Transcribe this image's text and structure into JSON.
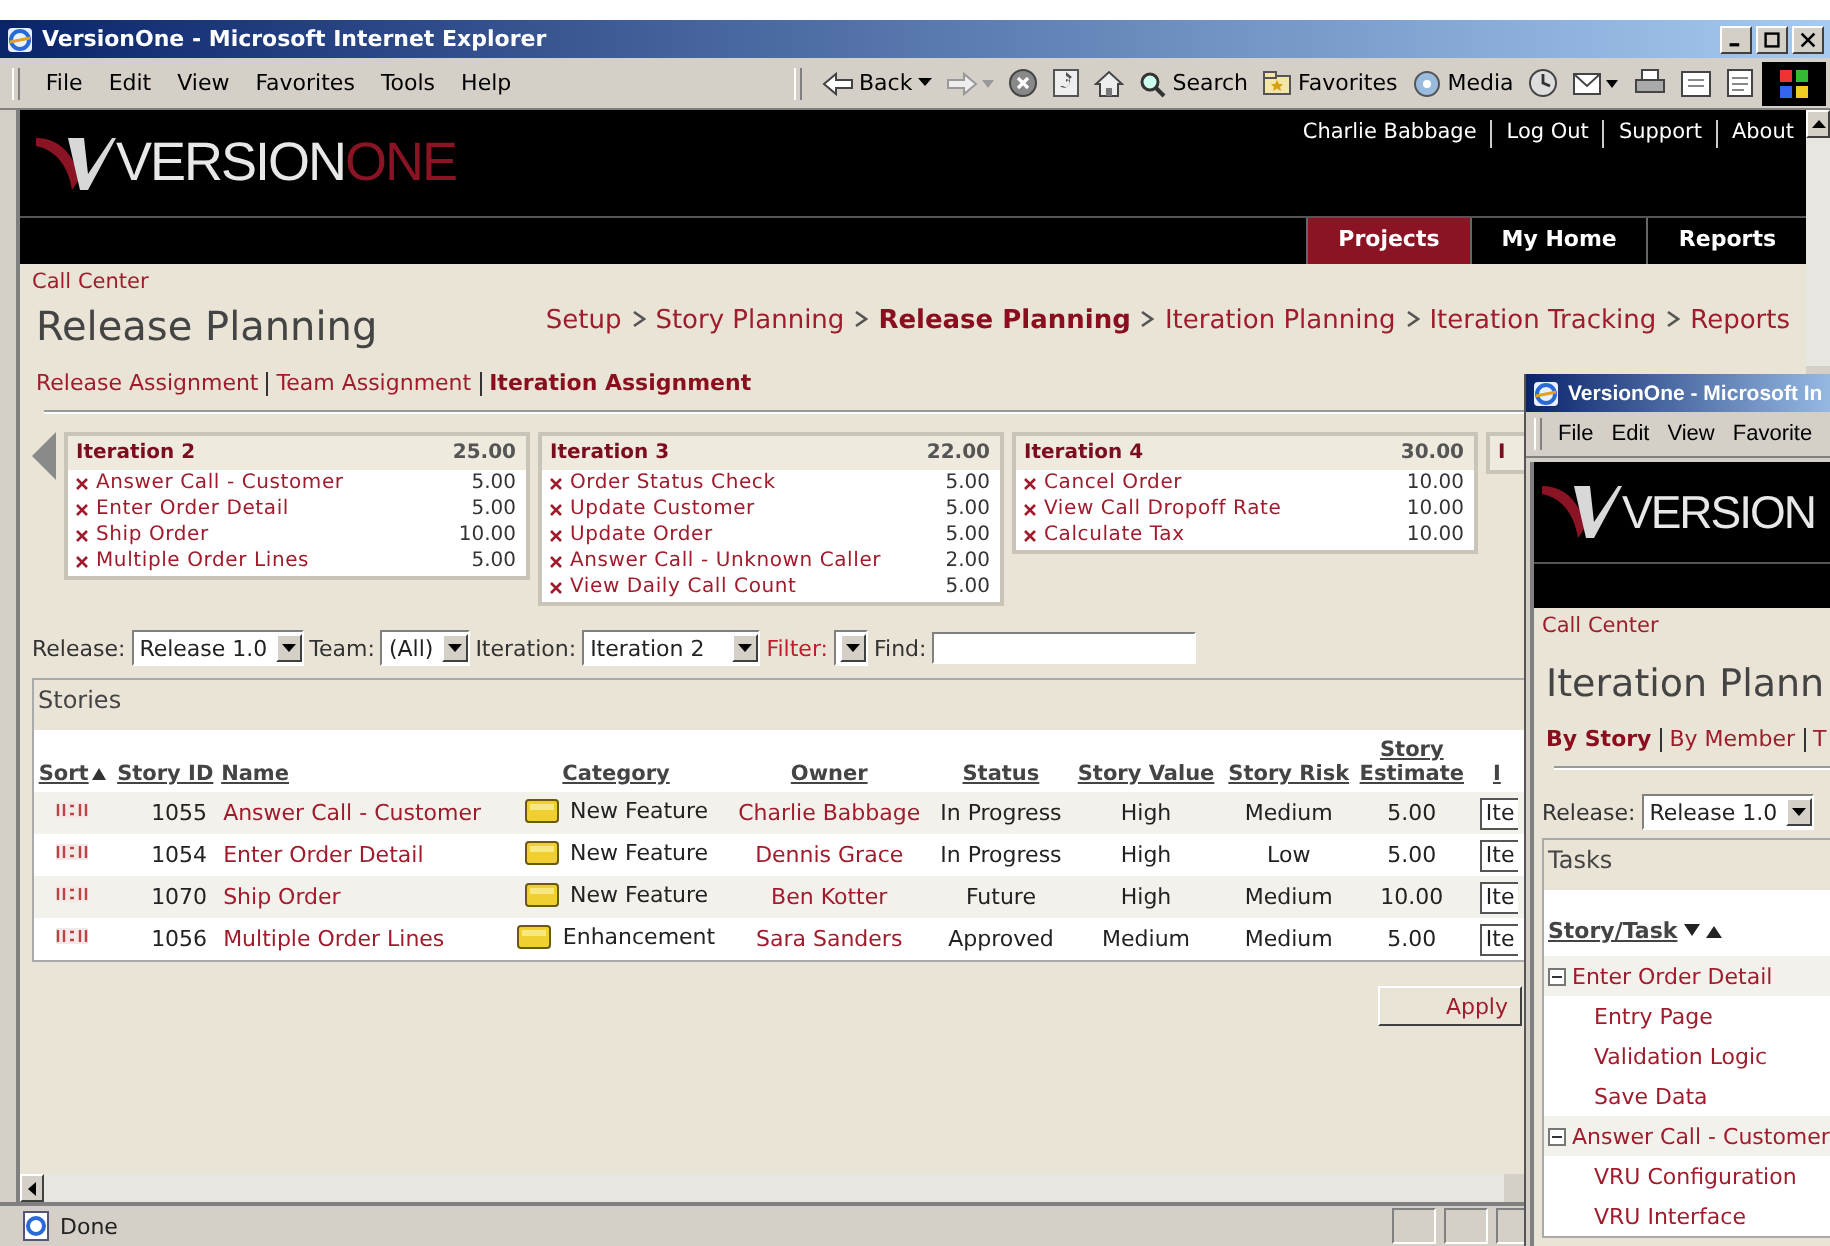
{
  "window": {
    "title": "VersionOne - Microsoft Internet Explorer"
  },
  "menu": [
    "File",
    "Edit",
    "View",
    "Favorites",
    "Tools",
    "Help"
  ],
  "toolbar": [
    {
      "kind": "back",
      "label": "Back"
    },
    {
      "kind": "forward"
    },
    {
      "kind": "stop"
    },
    {
      "kind": "refresh"
    },
    {
      "kind": "home"
    },
    {
      "kind": "search",
      "label": "Search"
    },
    {
      "kind": "favorites",
      "label": "Favorites"
    },
    {
      "kind": "media",
      "label": "Media"
    },
    {
      "kind": "history"
    },
    {
      "kind": "mail"
    },
    {
      "kind": "print"
    },
    {
      "kind": "edit"
    },
    {
      "kind": "discuss"
    }
  ],
  "logo": {
    "first": "VERSION",
    "second": "ONE"
  },
  "user_links": [
    "Charlie Babbage",
    "Log Out",
    "Support",
    "About"
  ],
  "nav_tabs": [
    {
      "label": "Projects",
      "selected": true
    },
    {
      "label": "My Home",
      "selected": false
    },
    {
      "label": "Reports",
      "selected": false
    }
  ],
  "project": "Call Center",
  "page_title": "Release Planning",
  "workflow": [
    {
      "label": "Setup",
      "selected": false
    },
    {
      "label": "Story Planning",
      "selected": false
    },
    {
      "label": "Release Planning",
      "selected": true
    },
    {
      "label": "Iteration Planning",
      "selected": false
    },
    {
      "label": "Iteration Tracking",
      "selected": false
    },
    {
      "label": "Reports",
      "selected": false
    }
  ],
  "subtabs": [
    {
      "label": "Release Assignment",
      "selected": false
    },
    {
      "label": "Team Assignment",
      "selected": false
    },
    {
      "label": "Iteration Assignment",
      "selected": true
    }
  ],
  "iterations": [
    {
      "title": "Iteration 2",
      "total": "25.00",
      "items": [
        {
          "name": "Answer Call - Customer",
          "estimate": "5.00"
        },
        {
          "name": "Enter Order Detail",
          "estimate": "5.00"
        },
        {
          "name": "Ship Order",
          "estimate": "10.00"
        },
        {
          "name": "Multiple Order Lines",
          "estimate": "5.00"
        }
      ]
    },
    {
      "title": "Iteration 3",
      "total": "22.00",
      "items": [
        {
          "name": "Order Status Check",
          "estimate": "5.00"
        },
        {
          "name": "Update Customer",
          "estimate": "5.00"
        },
        {
          "name": "Update Order",
          "estimate": "5.00"
        },
        {
          "name": "Answer Call - Unknown Caller",
          "estimate": "2.00"
        },
        {
          "name": "View Daily Call Count",
          "estimate": "5.00"
        }
      ]
    },
    {
      "title": "Iteration 4",
      "total": "30.00",
      "items": [
        {
          "name": "Cancel Order",
          "estimate": "10.00"
        },
        {
          "name": "View Call Dropoff Rate",
          "estimate": "10.00"
        },
        {
          "name": "Calculate Tax",
          "estimate": "10.00"
        }
      ]
    },
    {
      "title": "I"
    }
  ],
  "filters": [
    {
      "kind": "select",
      "label": "Release:",
      "link": false,
      "value": "Release 1.0"
    },
    {
      "kind": "select",
      "label": "Team:",
      "link": false,
      "value": "(All)"
    },
    {
      "kind": "select",
      "label": "Iteration:",
      "link": false,
      "value": "Iteration 2"
    },
    {
      "kind": "select",
      "label": "Filter:",
      "link": true
    },
    {
      "kind": "text",
      "label": "Find:",
      "link": false
    }
  ],
  "stories": {
    "title": "Stories",
    "columns": [
      {
        "kind": "sort",
        "label": "Sort",
        "sorted": true
      },
      {
        "kind": "id",
        "label": "Story ID",
        "sorted": false
      },
      {
        "kind": "name",
        "label": "Name",
        "sorted": false
      },
      {
        "kind": "category",
        "label": "Category",
        "sorted": false
      },
      {
        "kind": "owner",
        "label": "Owner",
        "sorted": false
      },
      {
        "kind": "status",
        "label": "Status",
        "sorted": false
      },
      {
        "kind": "value",
        "label": "Story Value",
        "sorted": false
      },
      {
        "kind": "risk",
        "label": "Story Risk",
        "sorted": false
      },
      {
        "kind": "estimate",
        "label": "Story Estimate",
        "sorted": false
      },
      {
        "kind": "iteration",
        "label": "I",
        "sorted": false
      }
    ],
    "rows": [
      {
        "id": "1055",
        "name": "Answer Call - Customer",
        "category": "New Feature",
        "owner": "Charlie Babbage",
        "status": "In Progress",
        "value": "High",
        "risk": "Medium",
        "estimate": "5.00",
        "iteration": "Ite"
      },
      {
        "id": "1054",
        "name": "Enter Order Detail",
        "category": "New Feature",
        "owner": "Dennis Grace",
        "status": "In Progress",
        "value": "High",
        "risk": "Low",
        "estimate": "5.00",
        "iteration": "Ite"
      },
      {
        "id": "1070",
        "name": "Ship Order",
        "category": "New Feature",
        "owner": "Ben Kotter",
        "status": "Future",
        "value": "High",
        "risk": "Medium",
        "estimate": "10.00",
        "iteration": "Ite"
      },
      {
        "id": "1056",
        "name": "Multiple Order Lines",
        "category": "Enhancement",
        "owner": "Sara Sanders",
        "status": "Approved",
        "value": "Medium",
        "risk": "Medium",
        "estimate": "5.00",
        "iteration": "Ite"
      }
    ]
  },
  "apply_button": "Apply",
  "status_bar": "Done",
  "popup": {
    "title": "VersionOne - Microsoft In",
    "menu": [
      "File",
      "Edit",
      "View",
      "Favorite"
    ],
    "logo": "VERSION",
    "project": "Call Center",
    "page_title": "Iteration Plann",
    "tabs": [
      {
        "label": "By Story",
        "selected": true
      },
      {
        "label": "By Member",
        "selected": false
      },
      {
        "label": "T",
        "selected": false
      }
    ],
    "release_label": "Release:",
    "release": "Release 1.0",
    "panel_title": "Tasks",
    "column": "Story/Task",
    "tree": [
      {
        "label": "Enter Order Detail",
        "expanded": true,
        "children": [
          {
            "label": "Entry Page"
          },
          {
            "label": "Validation Logic"
          },
          {
            "label": "Save Data"
          }
        ]
      },
      {
        "label": "Answer Call - Customer",
        "expanded": true,
        "children": [
          {
            "label": "VRU Configuration"
          },
          {
            "label": "VRU Interface"
          }
        ]
      }
    ]
  }
}
